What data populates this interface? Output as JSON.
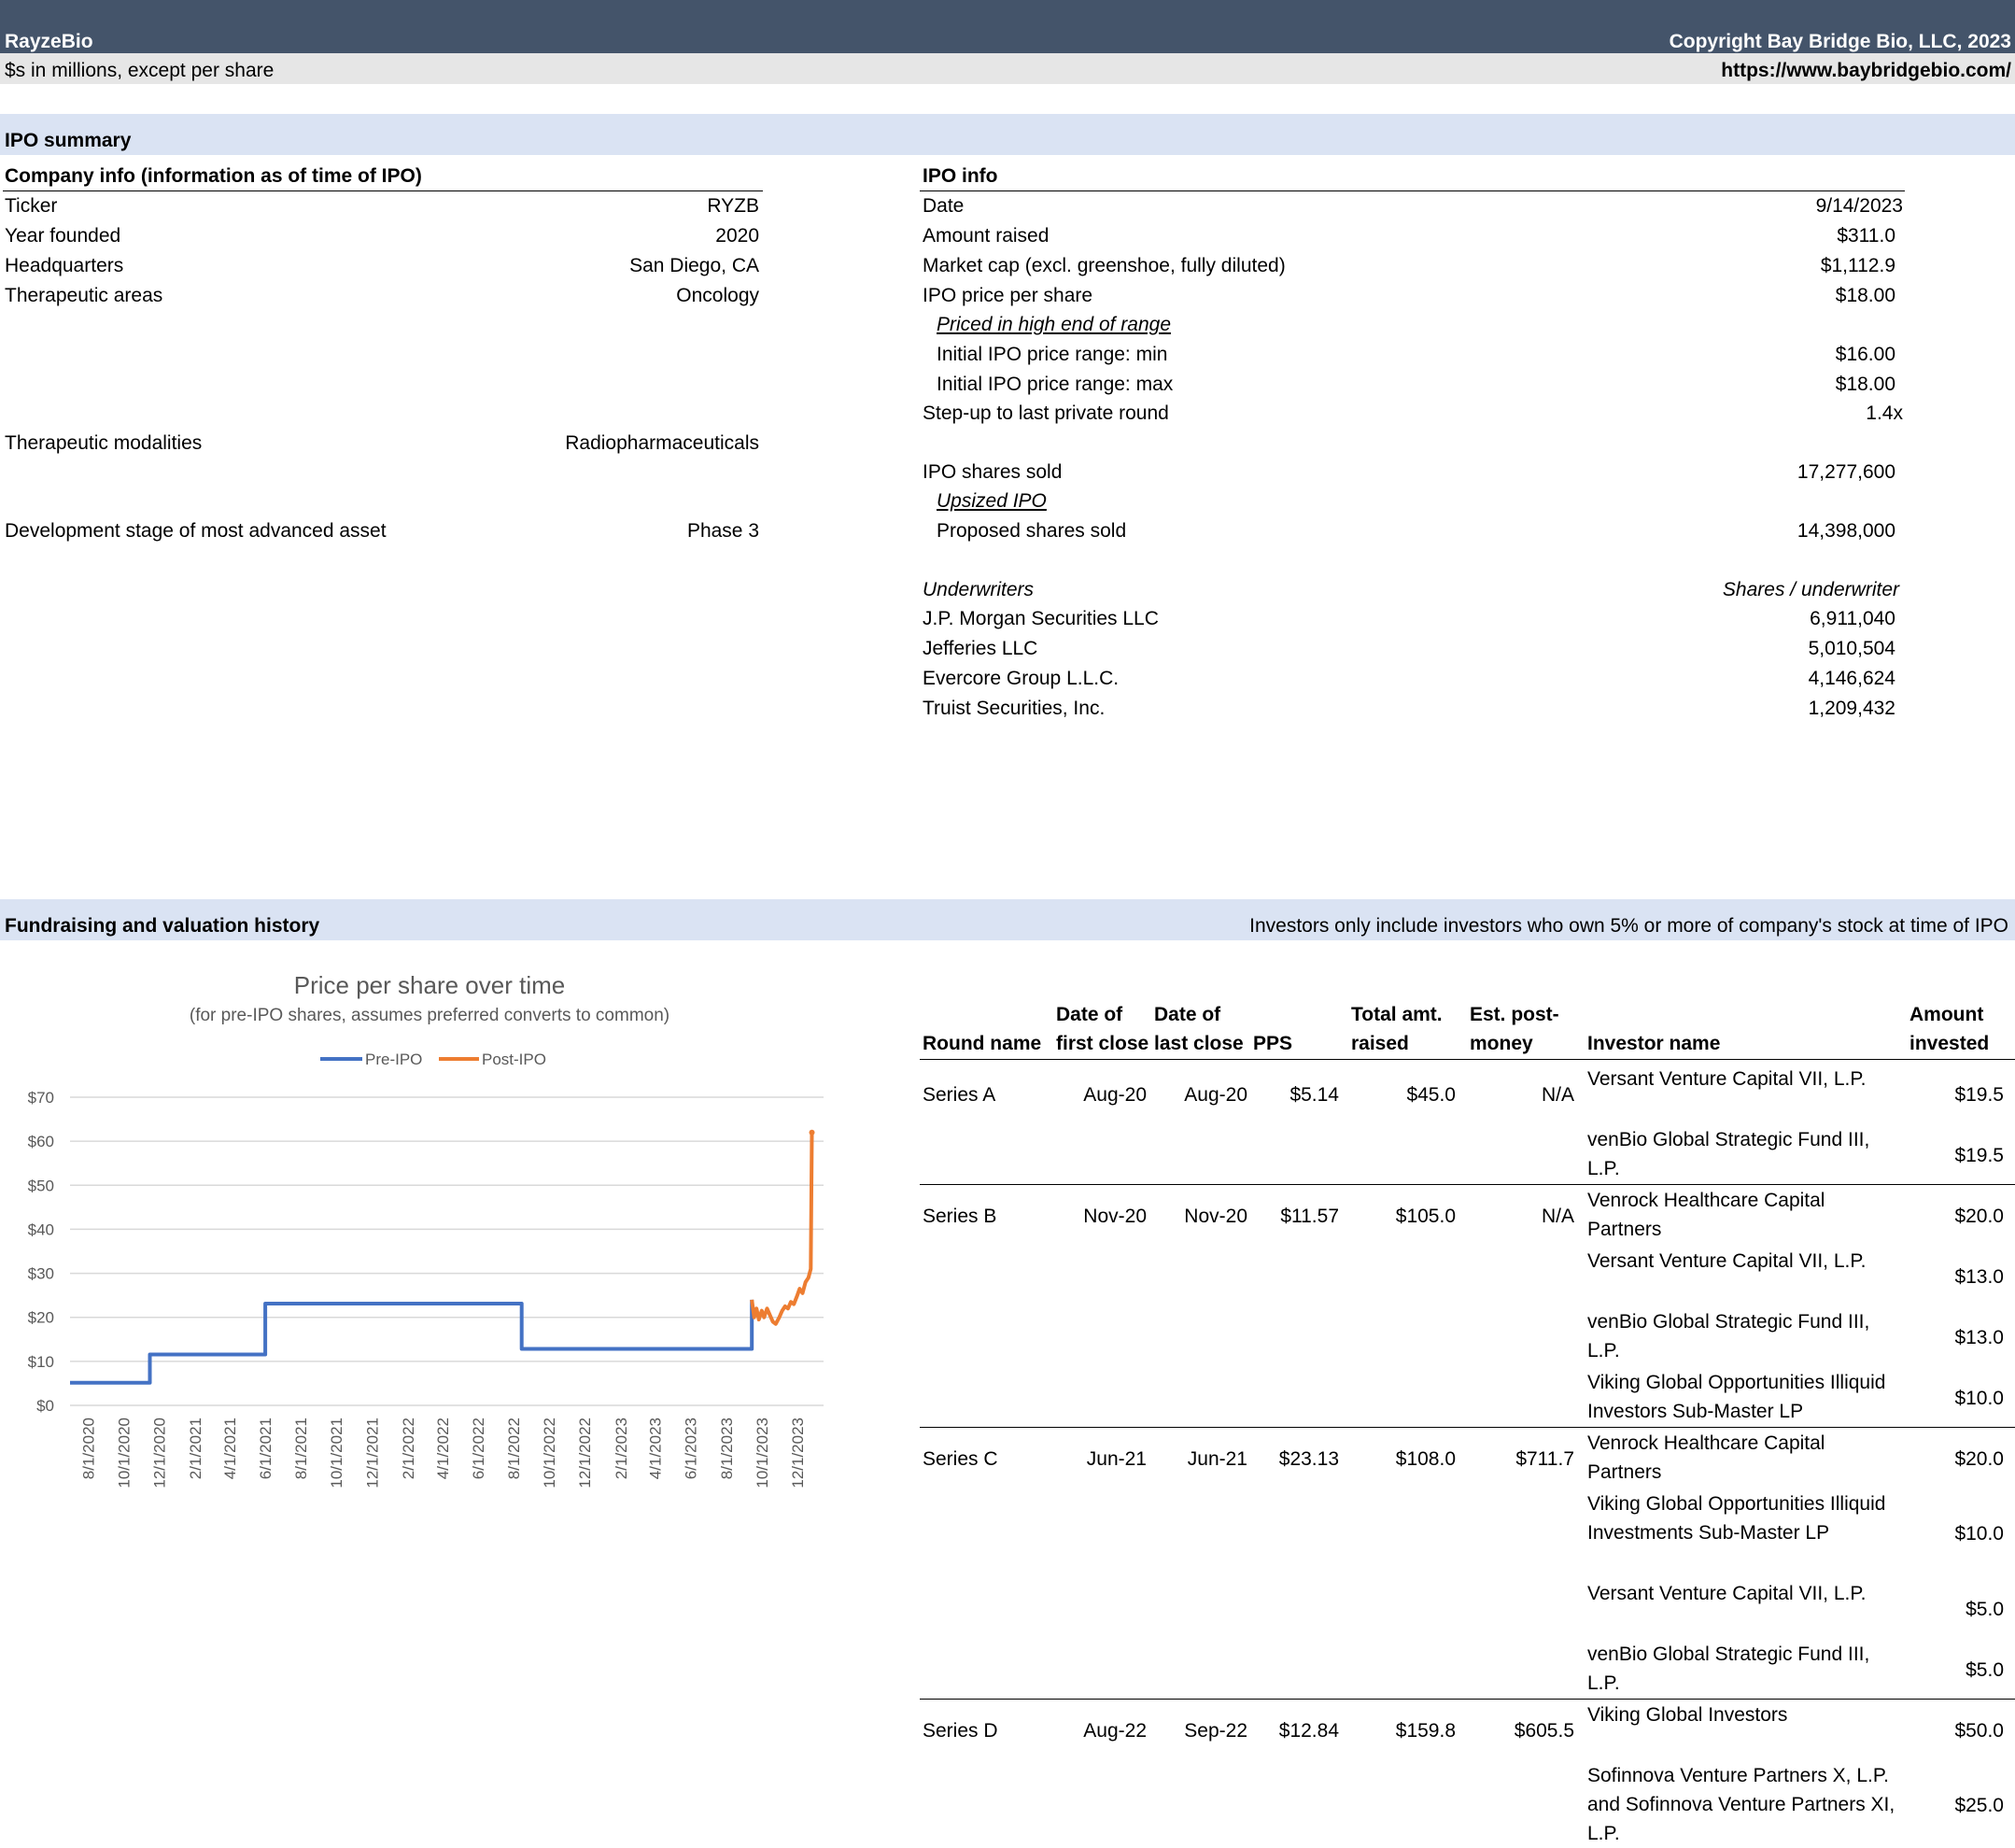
{
  "header": {
    "company": "RayzeBio",
    "copyright": "Copyright Bay Bridge Bio, LLC, 2023",
    "units_note": "$s in millions, except per share",
    "url": "https://www.baybridgebio.com/"
  },
  "ipo_summary": {
    "section_title": "IPO summary",
    "company_info": {
      "title": "Company info (information as of time of IPO)",
      "ticker_label": "Ticker",
      "ticker": "RYZB",
      "founded_label": "Year founded",
      "founded": "2020",
      "hq_label": "Headquarters",
      "hq": "San Diego, CA",
      "areas_label": "Therapeutic areas",
      "areas": "Oncology",
      "modalities_label": "Therapeutic modalities",
      "modalities": "Radiopharmaceuticals",
      "stage_label": "Development stage of most advanced asset",
      "stage": "Phase 3"
    },
    "ipo_info": {
      "title": "IPO info",
      "date_label": "Date",
      "date": "9/14/2023",
      "amount_label": "Amount raised",
      "amount": "$311.0",
      "mcap_label": "Market cap (excl. greenshoe, fully diluted)",
      "mcap": "$1,112.9",
      "price_label": "IPO price per share",
      "price": "$18.00",
      "priced_note": "Priced in high end of range",
      "min_label": "Initial IPO price range: min",
      "min": "$16.00",
      "max_label": "Initial IPO price range: max",
      "max": "$18.00",
      "stepup_label": "Step-up to last private round",
      "stepup": "1.4x",
      "shares_label": "IPO shares sold",
      "shares": "17,277,600",
      "upsized_note": "Upsized IPO",
      "proposed_label": "Proposed shares sold",
      "proposed": "14,398,000",
      "underwriters_label": "Underwriters",
      "shares_per_uw_label": "Shares / underwriter",
      "underwriters": [
        {
          "name": "J.P. Morgan Securities LLC",
          "shares": "6,911,040"
        },
        {
          "name": "Jefferies LLC",
          "shares": "5,010,504"
        },
        {
          "name": "Evercore Group L.L.C.",
          "shares": "4,146,624"
        },
        {
          "name": "Truist Securities, Inc.",
          "shares": "1,209,432"
        }
      ]
    }
  },
  "fundraising": {
    "section_title": "Fundraising and valuation history",
    "note": "Investors only include investors who own 5% or more of company's stock at time of IPO",
    "columns": {
      "round": "Round name",
      "first_close_1": "Date of",
      "first_close_2": "first close",
      "last_close_1": "Date of",
      "last_close_2": "last close",
      "pps": "PPS",
      "raised_1": "Total amt.",
      "raised_2": "raised",
      "postmoney_1": "Est. post-",
      "postmoney_2": "money",
      "investor": "Investor name",
      "invested_1": "Amount",
      "invested_2": "invested"
    },
    "rounds": [
      {
        "name": "Series A",
        "first": "Aug-20",
        "last": "Aug-20",
        "pps": "$5.14",
        "raised": "$45.0",
        "post": "N/A",
        "investors": [
          {
            "name": "Versant Venture Capital VII, L.P.",
            "amount": "$19.5"
          },
          {
            "name": "venBio Global Strategic Fund III, L.P.",
            "amount": "$19.5"
          }
        ]
      },
      {
        "name": "Series B",
        "first": "Nov-20",
        "last": "Nov-20",
        "pps": "$11.57",
        "raised": "$105.0",
        "post": "N/A",
        "investors": [
          {
            "name": "Venrock Healthcare Capital Partners",
            "amount": "$20.0"
          },
          {
            "name": "Versant Venture Capital VII, L.P.",
            "amount": "$13.0"
          },
          {
            "name": "venBio Global Strategic Fund III, L.P.",
            "amount": "$13.0"
          },
          {
            "name": "Viking Global Opportunities Illiquid Investors Sub-Master LP",
            "amount": "$10.0"
          }
        ]
      },
      {
        "name": "Series C",
        "first": "Jun-21",
        "last": "Jun-21",
        "pps": "$23.13",
        "raised": "$108.0",
        "post": "$711.7",
        "investors": [
          {
            "name": "Venrock Healthcare Capital Partners",
            "amount": "$20.0"
          },
          {
            "name": "Viking Global Opportunities Illiquid Investments Sub-Master LP",
            "amount": "$10.0"
          },
          {
            "name": "Versant Venture Capital VII, L.P.",
            "amount": "$5.0"
          },
          {
            "name": "venBio Global Strategic Fund III, L.P.",
            "amount": "$5.0"
          }
        ]
      },
      {
        "name": "Series D",
        "first": "Aug-22",
        "last": "Sep-22",
        "pps": "$12.84",
        "raised": "$159.8",
        "post": "$605.5",
        "investors": [
          {
            "name": "Viking Global Investors",
            "amount": "$50.0"
          },
          {
            "name": "Sofinnova Venture Partners X, L.P. and Sofinnova Venture Partners XI, L.P.",
            "amount": "$25.0"
          }
        ]
      }
    ]
  },
  "chart_data": {
    "type": "line",
    "title": "Price per share over time",
    "subtitle": "(for pre-IPO shares, assumes preferred converts to common)",
    "legend_position": "top-center",
    "ylim": [
      0,
      70
    ],
    "y_ticks": [
      "$0",
      "$10",
      "$20",
      "$30",
      "$40",
      "$50",
      "$60",
      "$70"
    ],
    "x_range": [
      "7/1/2020",
      "1/15/2024"
    ],
    "x_ticks": [
      "8/1/2020",
      "10/1/2020",
      "12/1/2020",
      "2/1/2021",
      "4/1/2021",
      "6/1/2021",
      "8/1/2021",
      "10/1/2021",
      "12/1/2021",
      "2/1/2022",
      "4/1/2022",
      "6/1/2022",
      "8/1/2022",
      "10/1/2022",
      "12/1/2022",
      "2/1/2023",
      "4/1/2023",
      "6/1/2023",
      "8/1/2023",
      "10/1/2023",
      "12/1/2023"
    ],
    "grid": true,
    "colors": {
      "pre": "#4472c4",
      "post": "#ed7d31",
      "grid": "#d9d9d9"
    },
    "series": [
      {
        "name": "Pre-IPO",
        "step": true,
        "points": [
          [
            "7/1/2020",
            5.14
          ],
          [
            "11/15/2020",
            5.14
          ],
          [
            "11/15/2020",
            11.57
          ],
          [
            "6/1/2021",
            11.57
          ],
          [
            "6/1/2021",
            23.13
          ],
          [
            "8/15/2022",
            23.13
          ],
          [
            "8/15/2022",
            12.84
          ],
          [
            "9/14/2023",
            12.84
          ],
          [
            "9/14/2023",
            24
          ]
        ]
      },
      {
        "name": "Post-IPO",
        "step": false,
        "points": [
          [
            "9/14/2023",
            24
          ],
          [
            "9/18/2023",
            20
          ],
          [
            "9/22/2023",
            22
          ],
          [
            "9/26/2023",
            19.5
          ],
          [
            "10/1/2023",
            21.5
          ],
          [
            "10/5/2023",
            20
          ],
          [
            "10/10/2023",
            22
          ],
          [
            "10/15/2023",
            20.5
          ],
          [
            "10/20/2023",
            19
          ],
          [
            "10/25/2023",
            18.5
          ],
          [
            "10/31/2023",
            20
          ],
          [
            "11/5/2023",
            21.5
          ],
          [
            "11/10/2023",
            22.5
          ],
          [
            "11/15/2023",
            22
          ],
          [
            "11/20/2023",
            23.5
          ],
          [
            "11/25/2023",
            23
          ],
          [
            "12/1/2023",
            25
          ],
          [
            "12/5/2023",
            26.5
          ],
          [
            "12/10/2023",
            25.5
          ],
          [
            "12/15/2023",
            28
          ],
          [
            "12/20/2023",
            29
          ],
          [
            "12/24/2023",
            31
          ],
          [
            "12/26/2023",
            62
          ]
        ]
      }
    ]
  }
}
